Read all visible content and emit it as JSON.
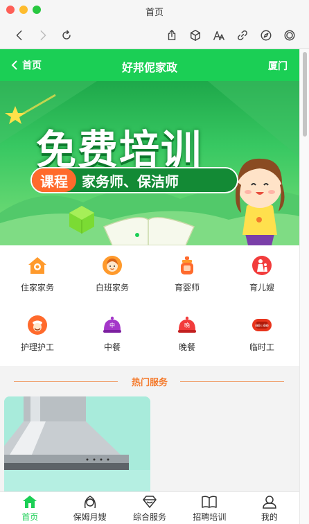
{
  "window": {
    "title": "首页"
  },
  "colors": {
    "brand_green": "#1bcf55",
    "accent_orange": "#f47a2c",
    "promo_orange": "#ff6a2c"
  },
  "toolbar": {
    "icons": [
      "back-arrow-icon",
      "forward-arrow-icon",
      "reload-icon",
      "share-icon",
      "cube-icon",
      "text-size-icon",
      "link-icon",
      "compass-icon",
      "target-icon"
    ]
  },
  "header": {
    "back_label": "首页",
    "title": "好邦伲家政",
    "city": "厦门"
  },
  "banner": {
    "headline": "免费培训",
    "tag": "课程",
    "subtitle": "家务师、保洁师",
    "slides_total": 1,
    "slide_active": 1
  },
  "categories": [
    {
      "label": "住家家务",
      "icon": "house-icon"
    },
    {
      "label": "白班家务",
      "icon": "woman-face-icon"
    },
    {
      "label": "育婴师",
      "icon": "baby-bottle-icon"
    },
    {
      "label": "育儿嫂",
      "icon": "mother-child-icon"
    },
    {
      "label": "护理护工",
      "icon": "nurse-icon"
    },
    {
      "label": "中餐",
      "icon": "lunch-cloche-icon"
    },
    {
      "label": "晚餐",
      "icon": "dinner-cloche-icon"
    },
    {
      "label": "临时工",
      "icon": "clock-icon"
    }
  ],
  "section": {
    "title": "热门服务"
  },
  "tabs": [
    {
      "label": "首页",
      "icon": "home-icon",
      "active": true
    },
    {
      "label": "保姆月嫂",
      "icon": "nanny-icon",
      "active": false
    },
    {
      "label": "综合服务",
      "icon": "diamond-icon",
      "active": false
    },
    {
      "label": "招聘培训",
      "icon": "book-icon",
      "active": false
    },
    {
      "label": "我的",
      "icon": "user-icon",
      "active": false
    }
  ]
}
